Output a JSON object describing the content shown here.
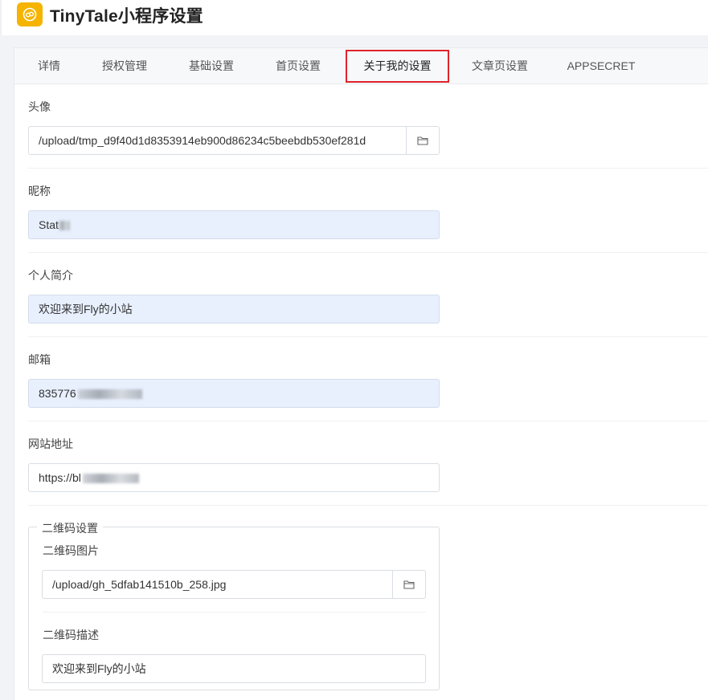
{
  "header": {
    "title": "TinyTale小程序设置",
    "logo_icon": "wechat-miniprogram-icon",
    "logo_color": "#f5b400"
  },
  "tabs": [
    {
      "label": "详情"
    },
    {
      "label": "授权管理"
    },
    {
      "label": "基础设置"
    },
    {
      "label": "首页设置"
    },
    {
      "label": "关于我的设置"
    },
    {
      "label": "文章页设置"
    },
    {
      "label": "APPSECRET"
    }
  ],
  "active_tab": "关于我的设置",
  "form": {
    "avatar": {
      "label": "头像",
      "value": "/upload/tmp_d9f40d1d8353914eb900d86234c5beebdb530ef281d"
    },
    "nickname": {
      "label": "昵称",
      "value": "Stat"
    },
    "bio": {
      "label": "个人简介",
      "value": "欢迎来到Fly的小站"
    },
    "email": {
      "label": "邮箱",
      "value": "835776"
    },
    "website": {
      "label": "网站地址",
      "value": "https://bl"
    },
    "qrcode": {
      "legend": "二维码设置",
      "image": {
        "label": "二维码图片",
        "value": "/upload/gh_5dfab141510b_258.jpg"
      },
      "description": {
        "label": "二维码描述",
        "value": "欢迎来到Fly的小站"
      }
    }
  },
  "colors": {
    "highlight_box": "#e0232b",
    "autofill_bg": "#e8f0fe"
  }
}
